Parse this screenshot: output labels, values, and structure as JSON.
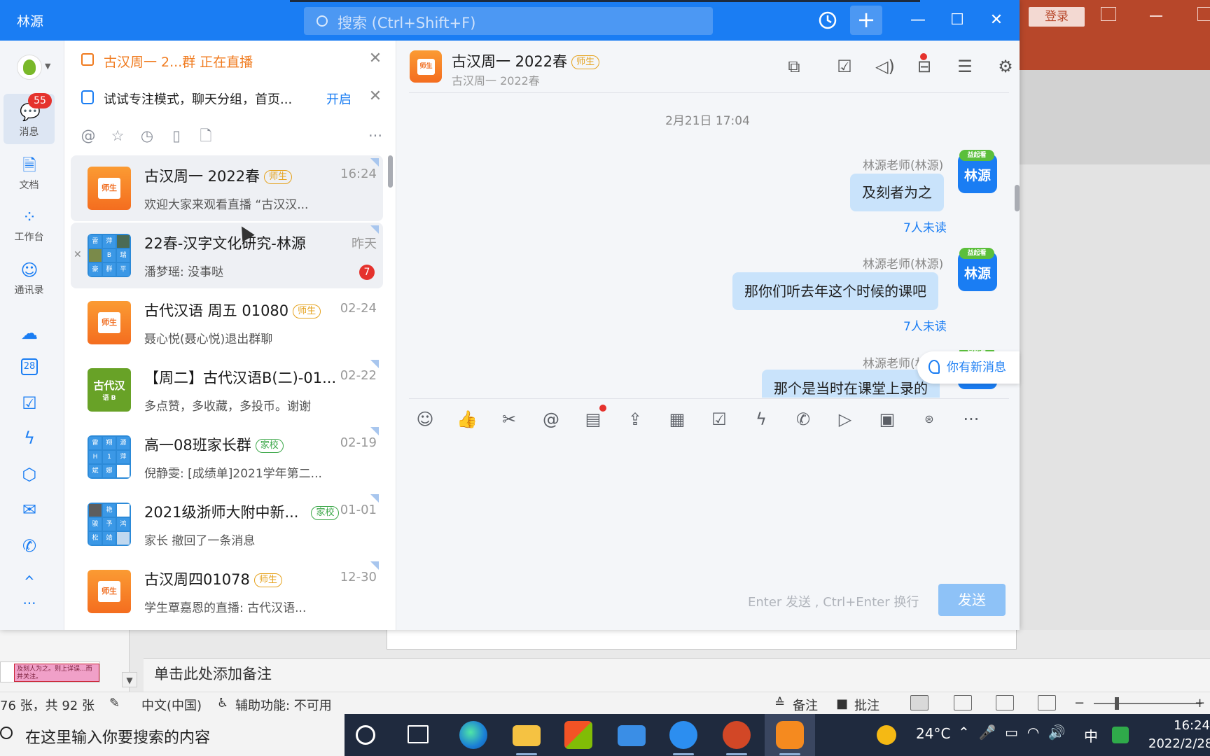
{
  "app": {
    "title": "林源",
    "search_placeholder": "搜索 (Ctrl+Shift+F)",
    "accent_color": "#1a7df3"
  },
  "rail": {
    "unread_badge": "55",
    "items": [
      {
        "label": "消息",
        "icon": "message-icon"
      },
      {
        "label": "文档",
        "icon": "document-icon"
      },
      {
        "label": "工作台",
        "icon": "apps-grid-icon"
      },
      {
        "label": "通讯录",
        "icon": "contacts-icon"
      }
    ],
    "extra_icons": [
      "cloud-icon",
      "calendar-icon",
      "todo-check-icon",
      "flash-icon",
      "cube-icon",
      "mail-icon",
      "phone-meeting-icon",
      "building-icon",
      "more-icon"
    ],
    "calendar_day": "28",
    "more": "···"
  },
  "banners": {
    "live": "古汉周一 2...群 正在直播",
    "focus_text": "试试专注模式，聊天分组，首页...",
    "focus_action": "开启"
  },
  "conversations": [
    {
      "title": "古汉周一 2022春",
      "tag": "师生",
      "time": "16:24",
      "preview": "欢迎大家来观看直播 “古汉汉..."
    },
    {
      "title": "22春-汉字文化研究-林源",
      "time": "昨天",
      "preview": "潘梦瑶: 没事哒",
      "unread": "7"
    },
    {
      "title": "古代汉语 周五 01080",
      "tag": "师生",
      "time": "02-24",
      "preview": "聂心悦(聂心悦)退出群聊"
    },
    {
      "title": "【周二】古代汉语B(二)-01...",
      "time": "02-22",
      "preview": "多点赞，多收藏，多投币。谢谢",
      "avatar_text": "古代汉",
      "avatar_sub": "语 B"
    },
    {
      "title": "高一08班家长群",
      "tag": "家校",
      "time": "02-19",
      "preview": "倪静雯: [成绩单]2021学年第二..."
    },
    {
      "title": "2021级浙师大附中新...",
      "tag": "家校",
      "time": "01-01",
      "preview": "家长 撤回了一条消息"
    },
    {
      "title": "古汉周四01078",
      "tag": "师生",
      "time": "12-30",
      "preview": "学生覃嘉恩的直播: 古代汉语..."
    }
  ],
  "avatar_grid_a": [
    "雷",
    "萍",
    "",
    "",
    "B",
    "瑞",
    "豪",
    "群",
    "平"
  ],
  "avatar_grid_b": [
    "雷",
    "翔",
    "源",
    "H",
    "1",
    "萍",
    "斌",
    "娜",
    ""
  ],
  "avatar_grid_c": [
    "",
    "艳",
    "",
    "骏",
    "予",
    "鸿",
    "松",
    "靖",
    ""
  ],
  "avatar_book_label": "师生",
  "chat": {
    "title": "古汉周一 2022春",
    "tag": "师生",
    "subtitle": "古汉周一 2022春",
    "date": "2月21日 17:04",
    "messages": [
      {
        "sender": "林源老师(林源)",
        "text": "及刻者为之",
        "status": "7人未读"
      },
      {
        "sender": "林源老师(林源)",
        "text": "那你们听去年这个时候的课吧",
        "status": "7人未读"
      },
      {
        "sender": "林源老师(林",
        "text": "那个是当时在课堂上录的"
      }
    ],
    "avatar_label": "林源",
    "avatar_cap": "益起看",
    "new_message_pill": "你有新消息",
    "input_hint": "Enter 发送 , Ctrl+Enter 换行",
    "send_label": "发送"
  },
  "powerpoint": {
    "login": "登录",
    "notes_placeholder": "单击此处添加备注",
    "thumb_text": "及刻人为之。则上详误...而并关注。",
    "status_slide": "76 张，共 92 张",
    "status_lang": "中文(中国)",
    "status_access": "辅助功能: 不可用",
    "status_notes": "备注",
    "status_comments": "批注",
    "zoom_minus": "−",
    "zoom_plus": "+"
  },
  "taskbar": {
    "search_placeholder": "在这里输入你要搜索的内容",
    "temperature": "24°C",
    "ime": "中",
    "time": "16:24",
    "date": "2022/2/28"
  }
}
